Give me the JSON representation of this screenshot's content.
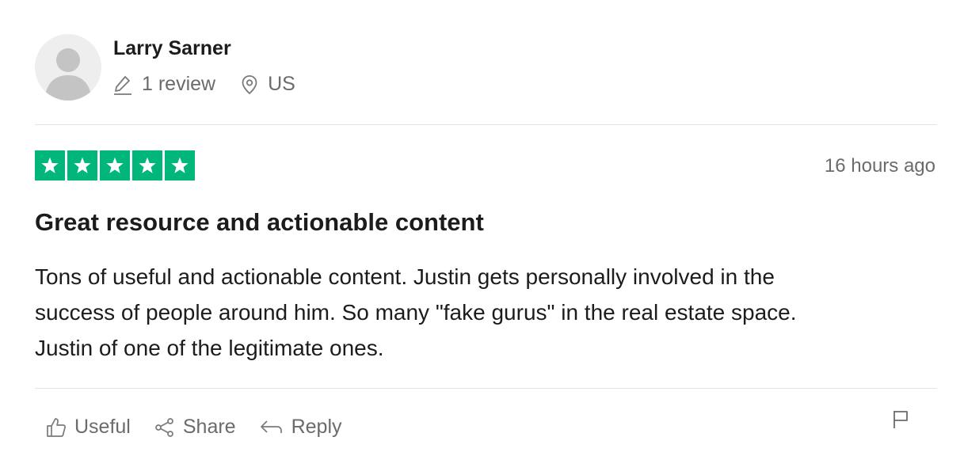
{
  "reviewer": {
    "name": "Larry Sarner",
    "review_count": "1 review",
    "country": "US"
  },
  "review": {
    "rating": 5,
    "rating_max": 5,
    "date": "16 hours ago",
    "title": "Great resource and actionable content",
    "body_lines": [
      "Tons of useful and actionable content. Justin gets personally involved in the",
      "success of people around him. So many \"fake gurus\" in the real estate space.",
      "Justin of one of the legitimate ones."
    ]
  },
  "actions": {
    "useful_label": "Useful",
    "share_label": "Share",
    "reply_label": "Reply"
  },
  "icons": {
    "avatar": "user-silhouette-icon",
    "review_count": "pencil-icon",
    "country": "location-pin-icon",
    "star": "star-icon",
    "useful": "thumbs-up-icon",
    "share": "share-icon",
    "reply": "reply-icon",
    "report": "flag-icon"
  },
  "colors": {
    "star_fill": "#00b67a",
    "muted_text": "#6b6b6b",
    "divider": "#e3e3e3"
  }
}
